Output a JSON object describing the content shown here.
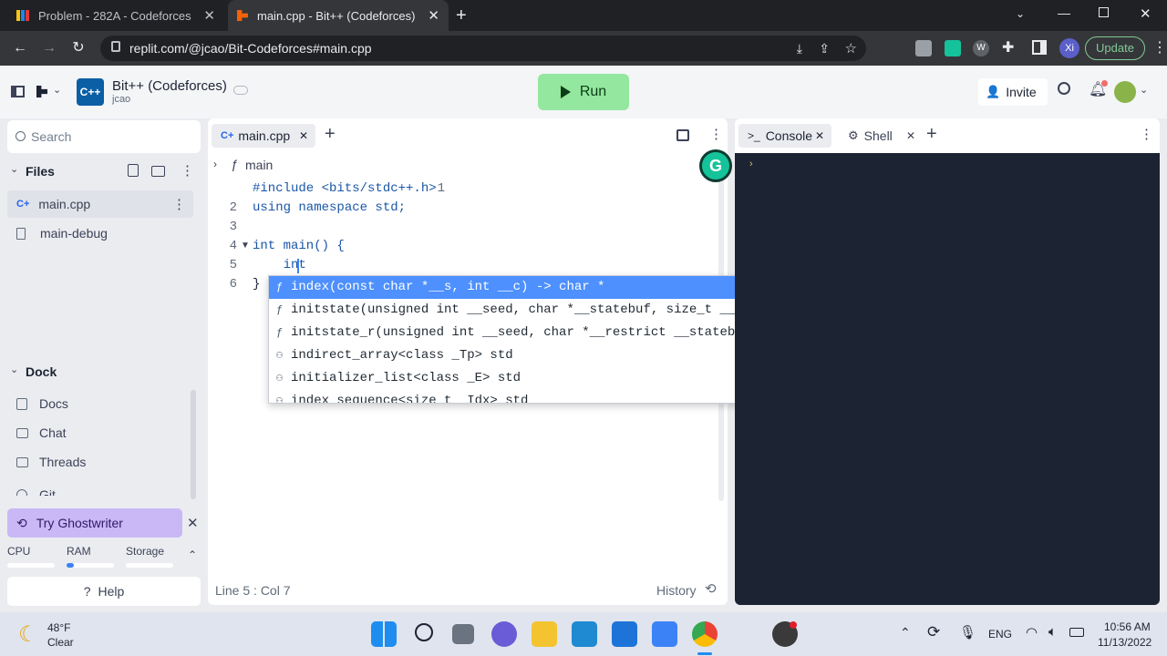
{
  "browser": {
    "tabs": [
      {
        "title": "Problem - 282A - Codeforces"
      },
      {
        "title": "main.cpp - Bit++ (Codeforces) -"
      }
    ],
    "url": "replit.com/@jcao/Bit-Codeforces#main.cpp",
    "update_label": "Update",
    "profile_initials": "Xi"
  },
  "header": {
    "repl_name": "Bit++ (Codeforces)",
    "owner": "jcao",
    "run_label": "Run",
    "invite_label": "Invite"
  },
  "sidebar": {
    "search_placeholder": "Search",
    "files_label": "Files",
    "files": [
      {
        "name": "main.cpp"
      },
      {
        "name": "main-debug"
      }
    ],
    "dock_label": "Dock",
    "dock_items": [
      {
        "label": "Docs"
      },
      {
        "label": "Chat"
      },
      {
        "label": "Threads"
      },
      {
        "label": "Git"
      }
    ],
    "ghostwriter_label": "Try Ghostwriter",
    "resources": [
      "CPU",
      "RAM",
      "Storage"
    ],
    "help_label": "Help"
  },
  "editor": {
    "tab_label": "main.cpp",
    "breadcrumb": "main",
    "lines": [
      {
        "n": "1",
        "text": "#include <bits/stdc++.h>"
      },
      {
        "n": "2",
        "text": "using namespace std;"
      },
      {
        "n": "3",
        "text": ""
      },
      {
        "n": "4",
        "text": "int main() {"
      },
      {
        "n": "5",
        "text": "    int "
      },
      {
        "n": "6",
        "text": "}"
      }
    ],
    "autocomplete": [
      "index(const char *__s, int __c) -> char *",
      "initstate(unsigned int __seed, char *__statebuf, size_t __sta…",
      "initstate_r(unsigned int __seed, char *__restrict __statebuf,…",
      "indirect_array<class _Tp> std",
      "initializer_list<class _E> std",
      "index_sequence<size_t _Idx> std"
    ],
    "status_position": "Line 5 : Col 7",
    "history_label": "History"
  },
  "console": {
    "tabs": [
      "Console",
      "Shell"
    ]
  },
  "taskbar": {
    "weather_temp": "48°F",
    "weather_desc": "Clear",
    "language": "ENG",
    "time": "10:56 AM",
    "date": "11/13/2022"
  },
  "colors": {
    "run_green": "#94e79e",
    "accent_blue": "#3b82f6",
    "console_bg": "#1c2333",
    "ghostwriter_purple": "#c9b8f5"
  }
}
